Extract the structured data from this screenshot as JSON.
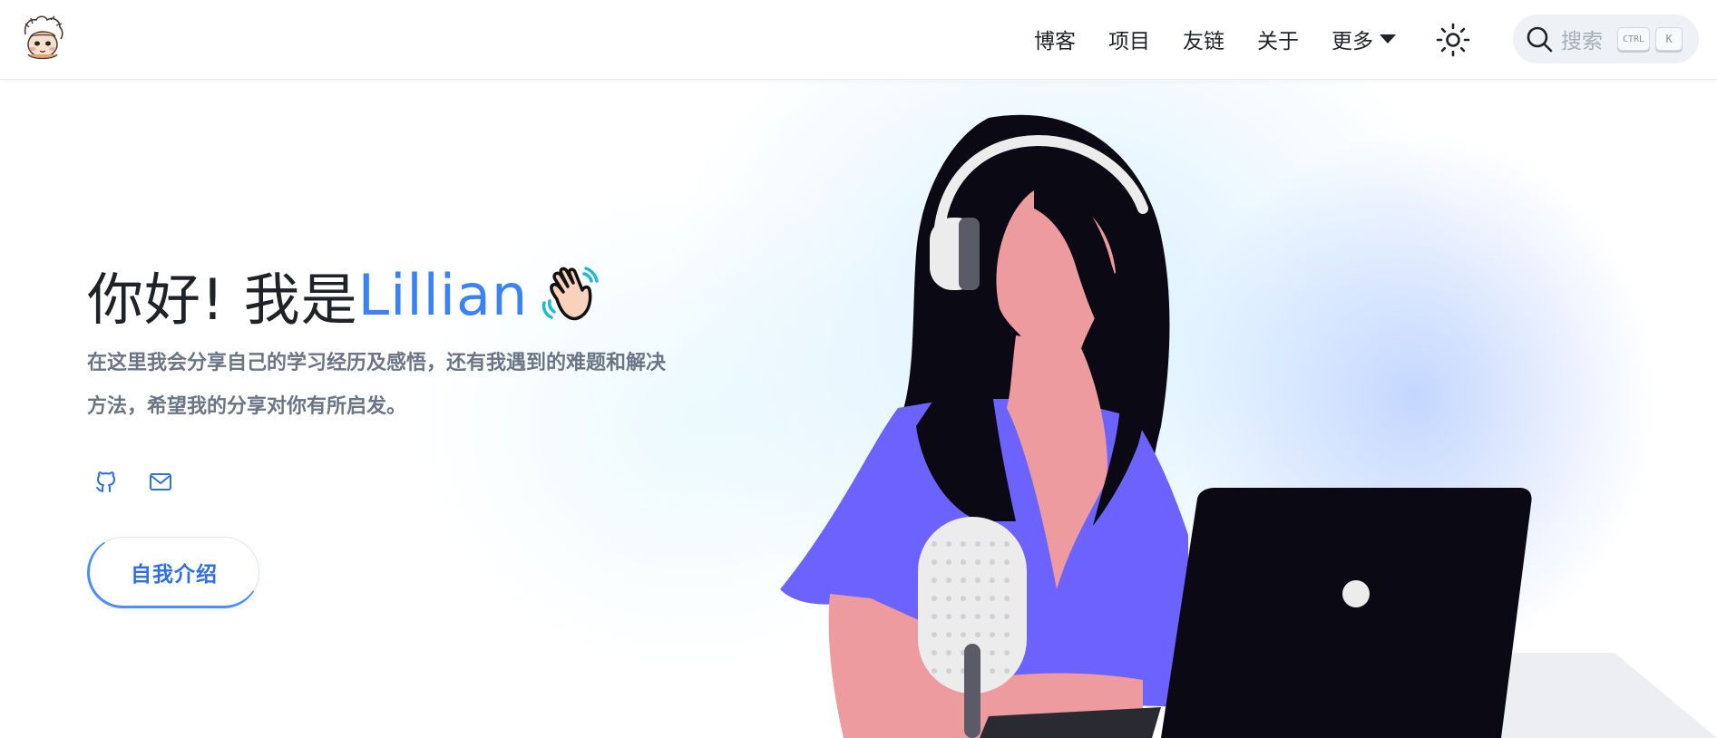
{
  "header": {
    "logo_icon": "cartoon-avatar-logo-icon",
    "nav": [
      {
        "label": "博客"
      },
      {
        "label": "项目"
      },
      {
        "label": "友链"
      },
      {
        "label": "关于"
      },
      {
        "label": "更多",
        "has_dropdown": true
      }
    ],
    "theme_toggle_icon": "sun-icon",
    "search": {
      "placeholder": "搜索",
      "shortcut_keys": [
        "CTRL",
        "K"
      ]
    }
  },
  "hero": {
    "greeting_prefix": "你好! 我是",
    "name": "Lillian",
    "wave_icon": "waving-hand-emoji-icon",
    "description_lines": [
      "在这里我会分享自己的学习经历及感悟，还有我遇到的难题和解决",
      "方法，希望我的分享对你有所启发。"
    ],
    "social_links": [
      {
        "icon": "github-icon"
      },
      {
        "icon": "mail-icon"
      }
    ],
    "intro_button_label": "自我介绍",
    "illustration": "woman-with-headphones-microphone-laptop"
  },
  "colors": {
    "accent": "#3b82f6",
    "nav_text": "#1f2328",
    "description_text": "#6a7585",
    "shirt": "#6c63ff",
    "skin": "#ed9b9e",
    "hair": "#0b0a14",
    "laptop": "#0b0a14"
  }
}
